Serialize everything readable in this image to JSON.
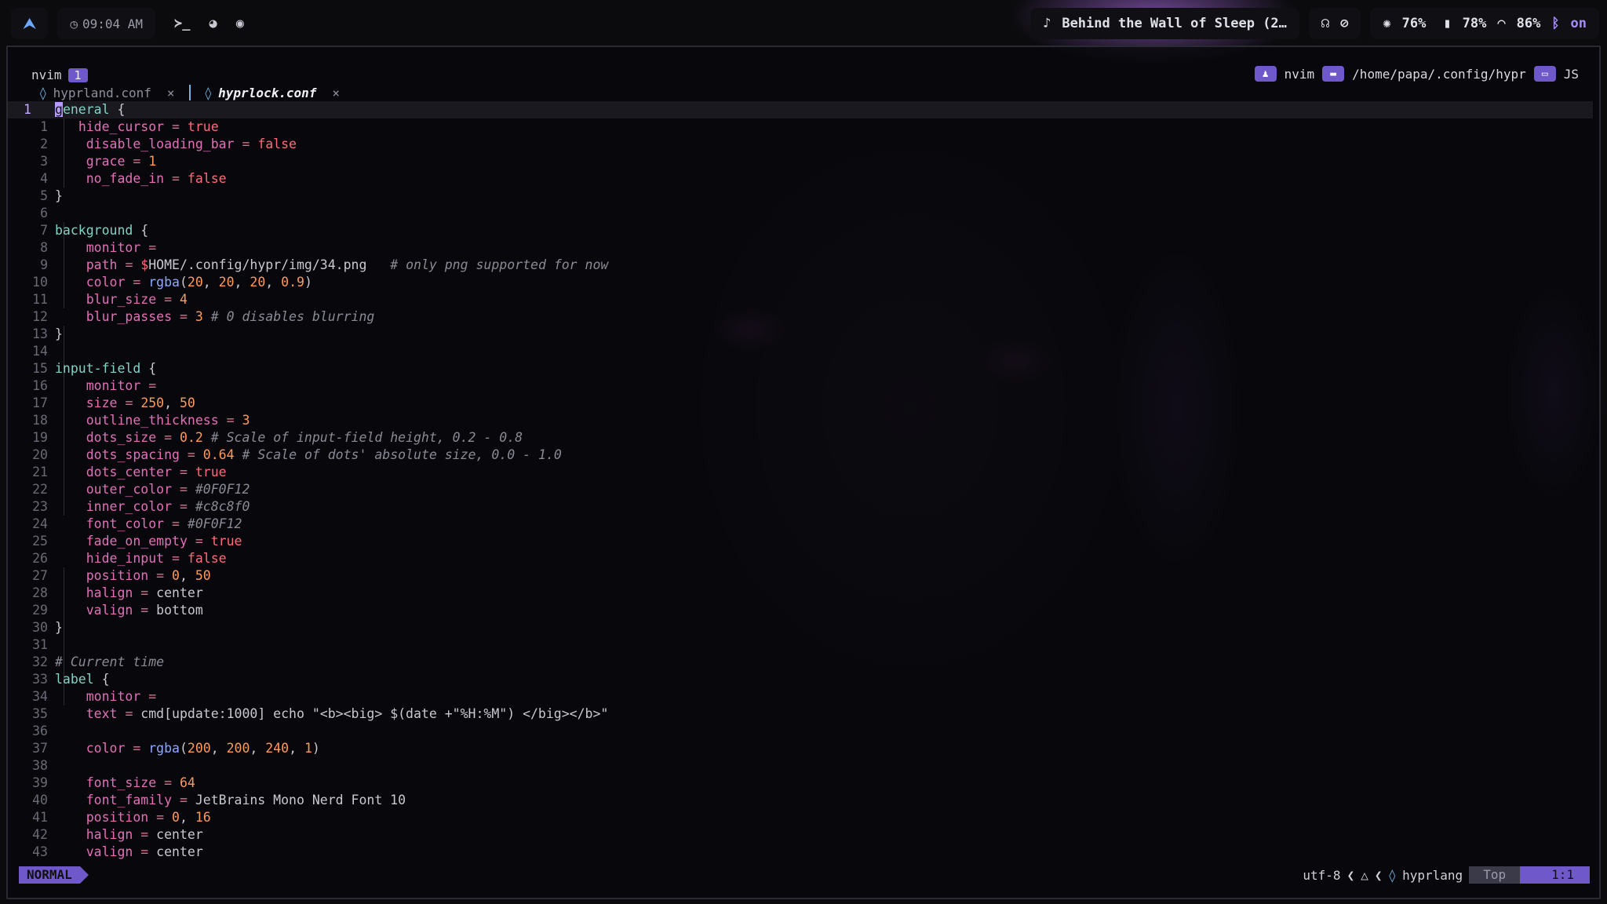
{
  "topbar": {
    "clock": "09:04 AM",
    "media": "Behind the Wall of Sleep (2…",
    "brightness": "76%",
    "battery": "78%",
    "wifi": "86%",
    "bluetooth": "on"
  },
  "terminal": {
    "tab_name": "nvim",
    "tab_number": "1",
    "process": "nvim",
    "cwd": "/home/papa/.config/hypr",
    "lang": "JS"
  },
  "editor": {
    "buffers": [
      {
        "name": "hyprland.conf",
        "active": false
      },
      {
        "name": "hyprlock.conf",
        "active": true
      }
    ],
    "close_glyph": "×"
  },
  "statusline": {
    "mode": "NORMAL",
    "encoding": "utf-8",
    "filetype": "hyprlang",
    "scroll": "Top",
    "position": "1:1"
  },
  "colors": {
    "accent": "#6f58c9",
    "key": "#e46fb8",
    "block": "#7fd3c7",
    "number": "#ff9a5a",
    "boolean": "#ff6b7a",
    "comment": "#8a8a96"
  }
}
